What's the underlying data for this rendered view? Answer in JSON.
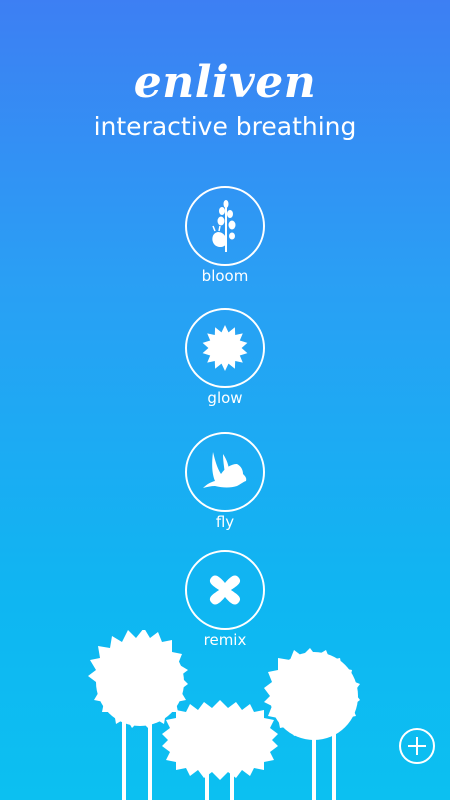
{
  "header": {
    "logo": "enliven",
    "subtitle": "interactive breathing"
  },
  "modes": [
    {
      "label": "bloom",
      "icon": "bloom-flower-icon"
    },
    {
      "label": "glow",
      "icon": "sun-icon"
    },
    {
      "label": "fly",
      "icon": "bird-icon"
    },
    {
      "label": "remix",
      "icon": "remix-x-icon"
    }
  ],
  "add_button": {
    "icon": "plus-icon"
  },
  "colors": {
    "gradient_top": "#3d7ff3",
    "gradient_bottom": "#0cc0f1",
    "foreground": "#ffffff"
  }
}
